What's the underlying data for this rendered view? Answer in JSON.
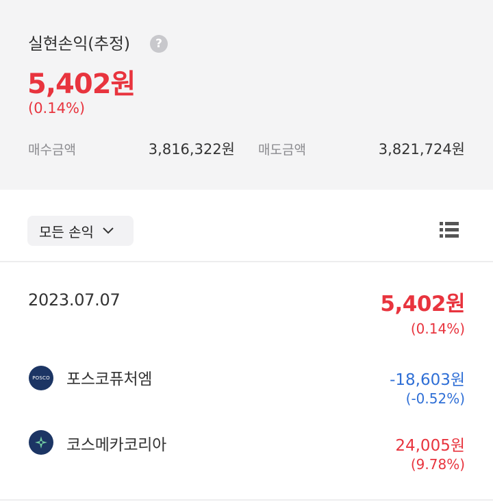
{
  "summary": {
    "title": "실현손익(추정)",
    "help_icon_glyph": "?",
    "amount": "5,402원",
    "percent": "(0.14%)",
    "buy_label": "매수금액",
    "buy_value": "3,816,322원",
    "sell_label": "매도금액",
    "sell_value": "3,821,724원"
  },
  "filter": {
    "label": "모든 손익"
  },
  "day": {
    "date": "2023.07.07",
    "amount": "5,402원",
    "percent": "(0.14%)"
  },
  "stocks": [
    {
      "name": "포스코퓨처엠",
      "logo_text": "POSCO",
      "amount": "-18,603원",
      "percent": "(-0.52%)",
      "direction": "down"
    },
    {
      "name": "코스메카코리아",
      "logo_icon": "star-icon",
      "amount": "24,005원",
      "percent": "(9.78%)",
      "direction": "up"
    }
  ],
  "colors": {
    "profit": "#e8343e",
    "loss": "#2f6fd6",
    "summary_bg": "#f4f4f5"
  }
}
